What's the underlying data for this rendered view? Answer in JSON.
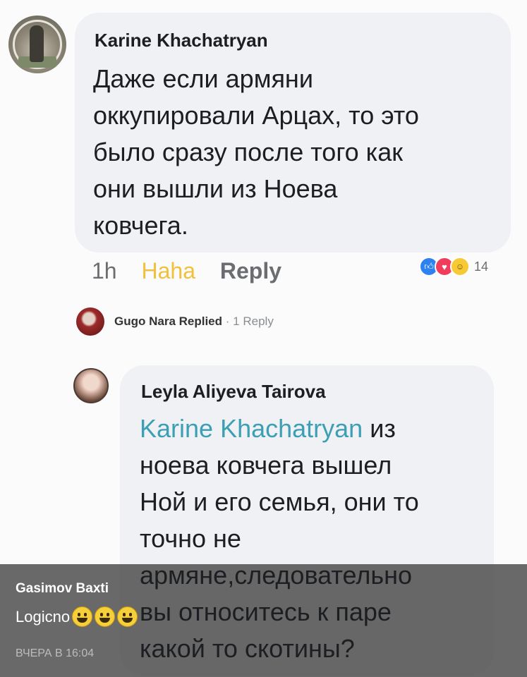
{
  "comment1": {
    "author": "Karine Khachatryan",
    "text_lines": [
      "Даже если армяни",
      "оккупировали Арцах, то это",
      "было сразу после того как",
      "они вышли из Ноева",
      "ковчега."
    ],
    "time": "1h",
    "reaction_action": "Haha",
    "reply_label": "Reply",
    "reactions": {
      "icons": [
        "like-icon",
        "love-icon",
        "haha-icon"
      ],
      "count": "14"
    }
  },
  "replied": {
    "text": "Gugo Nara Replied",
    "separator": "·",
    "reply_count": "1 Reply"
  },
  "comment2": {
    "author": "Leyla Aliyeva Tairova",
    "mention": "Karine Khachatryan",
    "text_first_rest": " из",
    "text_lines": [
      "ноева ковчега вышел",
      "Ной и его семья, они то",
      "точно не",
      "армяне,следовательно",
      "вы относитесь к паре",
      "какой то скотины?"
    ]
  },
  "overlay": {
    "name": "Gasimov Baxti",
    "message": "Logicno",
    "emoji": [
      "grinning-face",
      "grinning-face",
      "grinning-face"
    ],
    "time": "ВЧЕРА В 16:04"
  },
  "colors": {
    "bubble": "#eff1f4",
    "mention": "#3d9fb3",
    "haha": "#f2c03a",
    "overlay": "#505050"
  }
}
